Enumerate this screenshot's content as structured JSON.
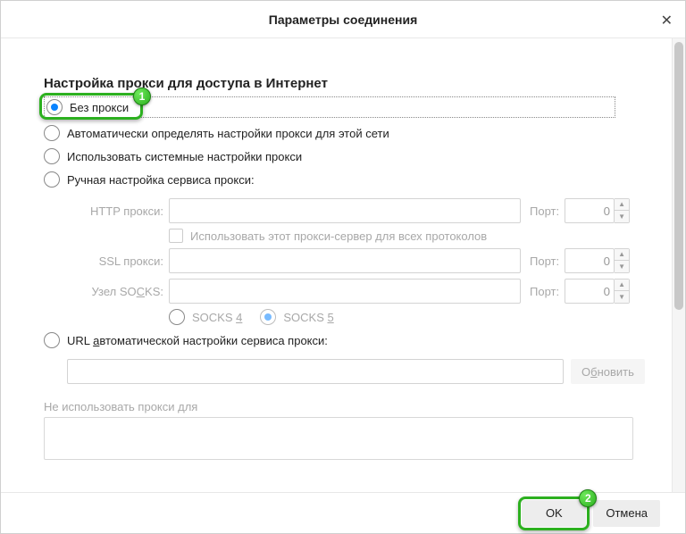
{
  "title": "Параметры соединения",
  "heading": "Настройка прокси для доступа в Интернет",
  "radios": {
    "none": "Без прокси",
    "auto_detect": "Автоматически определять настройки прокси для этой сети",
    "system": "Использовать системные настройки прокси",
    "manual": "Ручная настройка сервиса прокси:",
    "auto_url": "URL автоматической настройки сервиса прокси:"
  },
  "manual": {
    "http_label": "HTTP прокси:",
    "ssl_label": "SSL прокси:",
    "socks_label": "Узел SOCKS:",
    "port_label": "Порт:",
    "port_value": "0",
    "use_for_all": "Использовать этот прокси-сервер для всех протоколов",
    "socks4": "SOCKS 4",
    "socks5": "SOCKS 5"
  },
  "reload_label": "Обновить",
  "noproxy_label": "Не использовать прокси для",
  "footer": {
    "ok": "OK",
    "cancel": "Отмена"
  },
  "callouts": {
    "one": "1",
    "two": "2"
  }
}
